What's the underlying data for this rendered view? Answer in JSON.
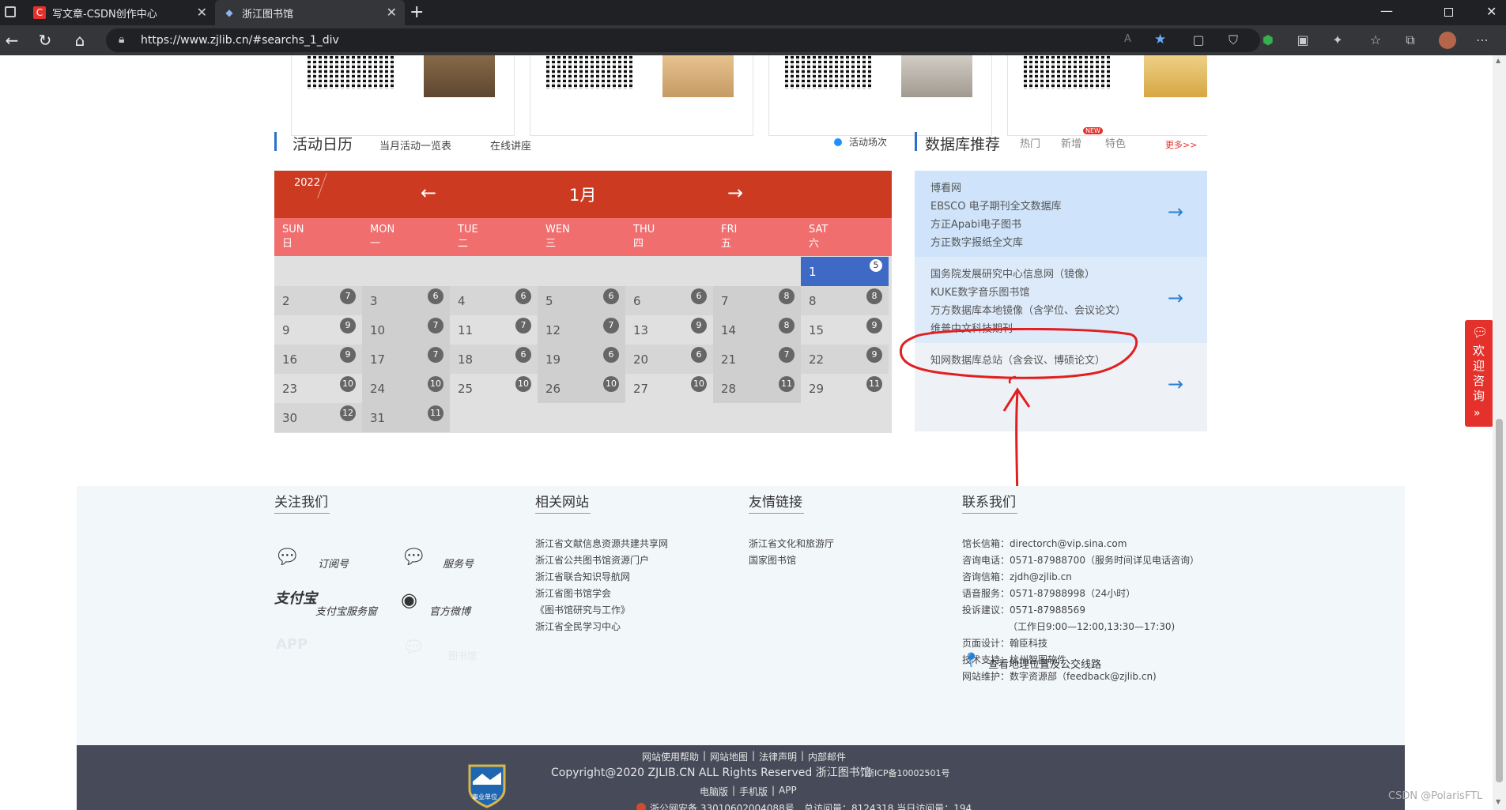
{
  "browser": {
    "tabs": [
      {
        "title": "写文章-CSDN创作中心"
      },
      {
        "title": "浙江图书馆"
      }
    ],
    "url": "https://www.zjlib.cn/#searchs_1_div"
  },
  "activity": {
    "title": "活动日历",
    "links": [
      "当月活动一览表",
      "在线讲座"
    ],
    "legend": "活动场次"
  },
  "calendar": {
    "year": "2022",
    "month": "1月",
    "days": [
      {
        "en": "SUN",
        "zh": "日"
      },
      {
        "en": "MON",
        "zh": "一"
      },
      {
        "en": "TUE",
        "zh": "二"
      },
      {
        "en": "WEN",
        "zh": "三"
      },
      {
        "en": "THU",
        "zh": "四"
      },
      {
        "en": "FRI",
        "zh": "五"
      },
      {
        "en": "SAT",
        "zh": "六"
      }
    ],
    "cells": [
      [
        "",
        "",
        "",
        "",
        "",
        "",
        "1"
      ],
      [
        "2",
        "3",
        "4",
        "5",
        "6",
        "7",
        "8"
      ],
      [
        "9",
        "10",
        "11",
        "12",
        "13",
        "14",
        "15"
      ],
      [
        "16",
        "17",
        "18",
        "19",
        "20",
        "21",
        "22"
      ],
      [
        "23",
        "24",
        "25",
        "26",
        "27",
        "28",
        "29"
      ],
      [
        "30",
        "31",
        "",
        "",
        "",
        "",
        ""
      ]
    ],
    "badges": [
      [
        "",
        "",
        "",
        "",
        "",
        "",
        "5"
      ],
      [
        "7",
        "6",
        "6",
        "6",
        "6",
        "8",
        "8"
      ],
      [
        "9",
        "7",
        "7",
        "7",
        "9",
        "8",
        "9"
      ],
      [
        "9",
        "7",
        "6",
        "6",
        "6",
        "7",
        "9"
      ],
      [
        "10",
        "10",
        "10",
        "10",
        "10",
        "11",
        "11"
      ],
      [
        "12",
        "11",
        "",
        "",
        "",
        "",
        ""
      ]
    ]
  },
  "database": {
    "title": "数据库推荐",
    "tabs": [
      "热门",
      "新增",
      "特色"
    ],
    "new_badge": "NEW",
    "more": "更多>>",
    "blocks": [
      [
        "博看网",
        "EBSCO 电子期刊全文数据库",
        "方正Apabi电子图书",
        "方正数字报纸全文库"
      ],
      [
        "国务院发展研究中心信息网（镜像）",
        "KUKE数字音乐图书馆",
        "万方数据库本地镜像（含学位、会议论文）",
        "维普中文科技期刊"
      ],
      [
        "知网数据库总站（含会议、博硕论文）"
      ]
    ]
  },
  "footer": {
    "follow": {
      "title": "关注我们",
      "items": [
        "订阅号",
        "服务号",
        "支付宝服务窗",
        "官方微博",
        "APP",
        "图书馆"
      ],
      "alipay_logo": "支付宝"
    },
    "related": {
      "title": "相关网站",
      "links": [
        "浙江省文献信息资源共建共享网",
        "浙江省公共图书馆资源门户",
        "浙江省联合知识导航网",
        "浙江省图书馆学会",
        "《图书馆研究与工作》",
        "浙江省全民学习中心"
      ]
    },
    "friends": {
      "title": "友情链接",
      "links": [
        "浙江省文化和旅游厅",
        "国家图书馆"
      ]
    },
    "contact": {
      "title": "联系我们",
      "lines": [
        "馆长信箱：directorch@vip.sina.com",
        "咨询电话：0571-87988700（服务时间详见电话咨询）",
        "咨询信箱：zjdh@zjlib.cn",
        "语音服务：0571-87988998（24小时）",
        "投诉建议：0571-87988569",
        "（工作日9:00—12:00,13:30—17:30)",
        "页面设计：翰臣科技",
        "技术支持：杭州智图软件",
        "网站维护：数字资源部（feedback@zjlib.cn)"
      ],
      "map": "查看地理位置及公交线路"
    },
    "bar": {
      "links": [
        "网站使用帮助",
        "网站地图",
        "法律声明",
        "内部邮件"
      ],
      "copyright": "Copyright@2020 ZJLIB.CN ALL Rights Reserved 浙江图书馆",
      "icp": "浙ICP备10002501号",
      "versions": [
        "电脑版",
        "手机版",
        "APP"
      ],
      "police": "浙公网安备 33010602004088号",
      "stats": "总访问量：8124318  当日访问量：194",
      "badge_text": "事业单位"
    }
  },
  "side": {
    "consult": "欢迎咨询"
  },
  "watermark": "CSDN @PolarisFTL"
}
